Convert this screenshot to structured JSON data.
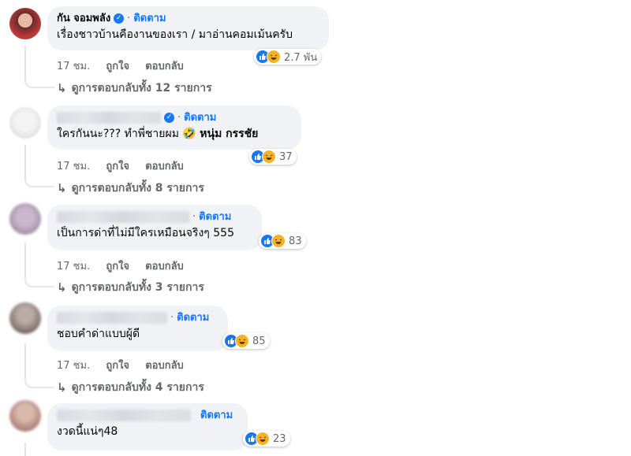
{
  "colors": {
    "link": "#1877f2",
    "bubble": "#f0f2f5",
    "muted": "#65676b",
    "haha": "#f7b125"
  },
  "comments": [
    {
      "name": "กัน จอมพลัง",
      "verified": true,
      "follow": "ติดตาม",
      "text": "เรื่องชาวบ้านคืองานของเรา / มาอ่านคอมเม้นครับ",
      "reactions": "2.7 พัน",
      "time": "17 ชม.",
      "like": "ถูกใจ",
      "reply": "ตอบกลับ",
      "replies": "ดูการตอบกลับทั้ง 12 รายการ"
    },
    {
      "name": "",
      "verified": true,
      "follow": "ติดตาม",
      "text": "ใครกันนะ??? ทำพี่ชายผม",
      "emoji": "🤣",
      "mention": "หนุ่ม กรรชัย",
      "reactions": "37",
      "time": "17 ชม.",
      "like": "ถูกใจ",
      "reply": "ตอบกลับ",
      "replies": "ดูการตอบกลับทั้ง 8 รายการ"
    },
    {
      "name": "",
      "follow": "ติดตาม",
      "text": "เป็นการด่าที่ไม่มีใครเหมือนจริงๆ 555",
      "reactions": "83",
      "time": "17 ชม.",
      "like": "ถูกใจ",
      "reply": "ตอบกลับ",
      "replies": "ดูการตอบกลับทั้ง 3 รายการ"
    },
    {
      "name": "",
      "follow": "ติดตาม",
      "text": "ชอบคำด่าแบบผู้ดี",
      "reactions": "85",
      "time": "17 ชม.",
      "like": "ถูกใจ",
      "reply": "ตอบกลับ",
      "replies": "ดูการตอบกลับทั้ง 4 รายการ"
    },
    {
      "name": "",
      "follow": "ติดตาม",
      "text": "งวดนี้แน่ๆ48",
      "reactions": "23"
    }
  ]
}
